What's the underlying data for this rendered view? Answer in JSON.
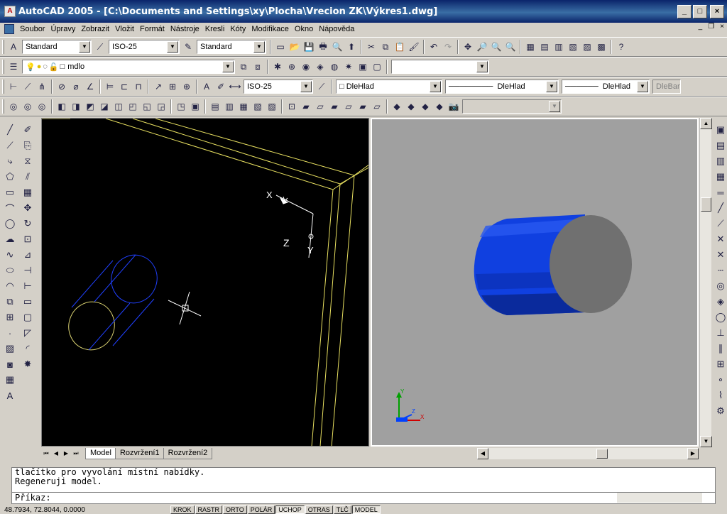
{
  "window": {
    "app_icon": "AutoCAD",
    "title": "AutoCAD 2005 - [C:\\Documents and Settings\\xy\\Plocha\\Vrecion ZK\\Výkres1.dwg]",
    "buttons": {
      "minimize": "_",
      "maximize": "□",
      "close": "×"
    }
  },
  "menu": {
    "items": [
      "Soubor",
      "Úpravy",
      "Zobrazit",
      "Vložit",
      "Formát",
      "Nástroje",
      "Kresli",
      "Kóty",
      "Modifikace",
      "Okno",
      "Nápověda"
    ],
    "mdi_buttons": {
      "minimize": "_",
      "restore": "❐",
      "close": "×"
    }
  },
  "toolbars": {
    "text_style": "Standard",
    "dim_style": "ISO-25",
    "table_style": "Standard",
    "layer": "mdlo",
    "view_combo": "",
    "dim_style_2": "ISO-25",
    "color": "DleHlad",
    "linetype": "DleHlad",
    "lineweight": "DleHlad",
    "plotstyle": "DleBarvy",
    "disabled_combo": ""
  },
  "left_viewport": {
    "ucs_labels": {
      "x": "X",
      "y": "Y",
      "z": "Z"
    },
    "colors": {
      "background": "#000000",
      "wall": "#e8e060",
      "cylinder_blue": "#2040ff",
      "cylinder_yellow": "#d8d070",
      "cursor": "#ffffff"
    }
  },
  "right_viewport": {
    "ucs_labels": {
      "x": "X",
      "y": "Y",
      "z": "Z"
    },
    "colors": {
      "background": "#a0a0a0",
      "cylinder_side": "#1040e0",
      "cylinder_end": "#707070"
    }
  },
  "tabs": {
    "nav": [
      "⏮",
      "◀",
      "▶",
      "⏭"
    ],
    "items": [
      {
        "label": "Model",
        "active": true
      },
      {
        "label": "Rozvržení1",
        "active": false
      },
      {
        "label": "Rozvržení2",
        "active": false
      }
    ]
  },
  "command": {
    "history": [
      "tlačítko pro vyvolání místní nabídky.",
      "Regeneruji model."
    ],
    "prompt": "Příkaz:"
  },
  "status": {
    "coords": "48.7934, 72.8044, 0.0000",
    "buttons": [
      {
        "label": "KROK",
        "on": false
      },
      {
        "label": "RASTR",
        "on": false
      },
      {
        "label": "ORTO",
        "on": false
      },
      {
        "label": "POLÁR",
        "on": false
      },
      {
        "label": "UCHOP",
        "on": true
      },
      {
        "label": "OTRAS",
        "on": false
      },
      {
        "label": "TLČ",
        "on": false
      },
      {
        "label": "MODEL",
        "on": true
      }
    ]
  }
}
